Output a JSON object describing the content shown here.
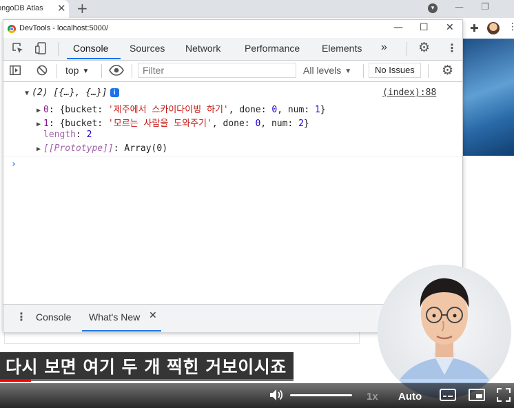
{
  "browser": {
    "tab_title": "ongoDB Atlas",
    "tab_close": "✕",
    "new_tab": "+",
    "profile_badge": "▾",
    "min_icon": "—",
    "restore_icon": "❐"
  },
  "devtools": {
    "window_title": "DevTools - localhost:5000/",
    "window_controls": {
      "minimize": "—",
      "maximize": "☐",
      "close": "✕"
    },
    "tabs": [
      {
        "label": "Console",
        "active": true
      },
      {
        "label": "Sources"
      },
      {
        "label": "Network"
      },
      {
        "label": "Performance"
      },
      {
        "label": "Elements"
      }
    ],
    "more_tabs": "»",
    "filter_bar": {
      "context": "top",
      "filter_placeholder": "Filter",
      "levels": "All levels",
      "issues_button": "No Issues"
    },
    "console": {
      "summary": "(2) [{…}, {…}]",
      "source": "(index):88",
      "items": [
        {
          "index": "0",
          "bucket": "'제주에서 스카이다이빙 하기'",
          "done": "0",
          "num": "1"
        },
        {
          "index": "1",
          "bucket": "'모르는 사람을 도와주기'",
          "done": "0",
          "num": "2"
        }
      ],
      "length_key": "length",
      "length_value": "2",
      "prototype_key": "[[Prototype]]",
      "prototype_value": "Array(0)",
      "prompt": "›"
    },
    "drawer": {
      "tabs": [
        {
          "label": "Console"
        },
        {
          "label": "What's New",
          "active": true
        }
      ],
      "close": "✕"
    }
  },
  "video": {
    "subtitle": "다시 보면 여기 두 개 찍힌 거보이시죠",
    "progress_fraction": 0.06,
    "speed": "1x",
    "quality": "Auto"
  },
  "colors": {
    "accent": "#1a73e8",
    "progress": "#ff0000"
  }
}
